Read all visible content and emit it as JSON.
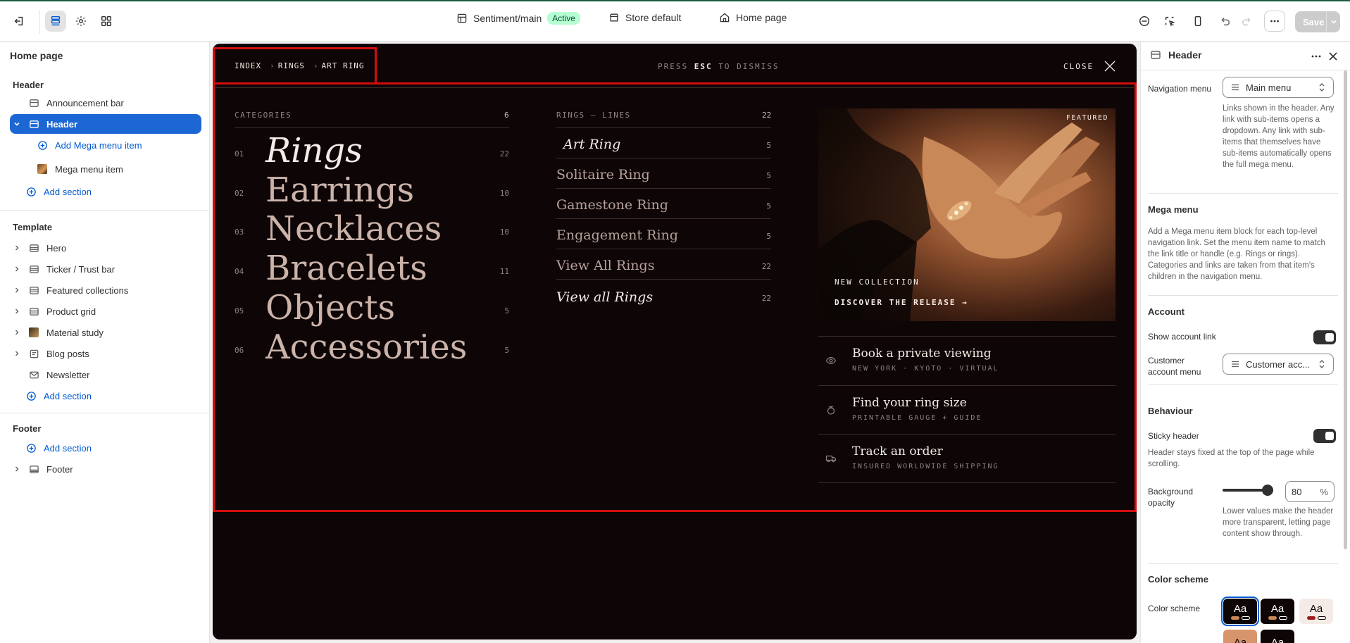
{
  "topbar": {
    "theme_name": "Sentiment/main",
    "status_badge": "Active",
    "store": "Store default",
    "page": "Home page",
    "save_label": "Save"
  },
  "left_panel": {
    "title": "Home page",
    "header_section": "Header",
    "header_items": [
      "Announcement bar",
      "Header",
      "Add Mega menu item",
      "Mega menu item",
      "Add section"
    ],
    "template_section": "Template",
    "template_items": [
      "Hero",
      "Ticker / Trust bar",
      "Featured collections",
      "Product grid",
      "Material study",
      "Blog posts",
      "Newsletter",
      "Add section"
    ],
    "footer_section": "Footer",
    "footer_items": [
      "Add section",
      "Footer"
    ]
  },
  "preview": {
    "breadcrumb": [
      "INDEX",
      "›",
      "RINGS",
      "›",
      "ART RING"
    ],
    "dismiss_pre": "PRESS",
    "dismiss_key": "ESC",
    "dismiss_post": "TO DISMISS",
    "close_label": "CLOSE",
    "categories_label": "CATEGORIES",
    "categories_count": "6",
    "categories": [
      {
        "num": "01",
        "name": "Rings",
        "count": "22"
      },
      {
        "num": "02",
        "name": "Earrings",
        "count": "10"
      },
      {
        "num": "03",
        "name": "Necklaces",
        "count": "10"
      },
      {
        "num": "04",
        "name": "Bracelets",
        "count": "11"
      },
      {
        "num": "05",
        "name": "Objects",
        "count": "5"
      },
      {
        "num": "06",
        "name": "Accessories",
        "count": "5"
      }
    ],
    "lines_label": "RINGS — LINES",
    "lines_count": "22",
    "lines": [
      {
        "name": "Art Ring",
        "count": "5"
      },
      {
        "name": "Solitaire Ring",
        "count": "5"
      },
      {
        "name": "Gamestone Ring",
        "count": "5"
      },
      {
        "name": "Engagement Ring",
        "count": "5"
      },
      {
        "name": "View All Rings",
        "count": "22"
      },
      {
        "name": "View all Rings",
        "count": "22"
      }
    ],
    "featured_tag": "FEATURED",
    "featured_kicker": "NEW COLLECTION",
    "featured_cta": "DISCOVER THE RELEASE →",
    "services": [
      {
        "title": "Book a private viewing",
        "sub": "NEW YORK · KYOTO · VIRTUAL",
        "icon": "eye-icon"
      },
      {
        "title": "Find your ring size",
        "sub": "PRINTABLE GAUGE + GUIDE",
        "icon": "ring-icon"
      },
      {
        "title": "Track an order",
        "sub": "INSURED WORLDWIDE SHIPPING",
        "icon": "truck-icon"
      }
    ]
  },
  "right_panel": {
    "title": "Header",
    "nav_menu_label": "Navigation menu",
    "nav_menu_value": "Main menu",
    "nav_menu_help": "Links shown in the header. Any link with sub-items opens a dropdown. Any link with sub-items that themselves have sub-items automatically opens the full mega menu.",
    "mega_title": "Mega menu",
    "mega_help": "Add a Mega menu item block for each top-level navigation link. Set the menu item name to match the link title or handle (e.g. Rings or rings). Categories and links are taken from that item's children in the navigation menu.",
    "account_title": "Account",
    "show_account_label": "Show account link",
    "customer_menu_label": "Customer account menu",
    "customer_menu_value": "Customer acc...",
    "behaviour_title": "Behaviour",
    "sticky_label": "Sticky header",
    "sticky_help": "Header stays fixed at the top of the page while scrolling.",
    "bg_opacity_label": "Background opacity",
    "bg_opacity_value": "80",
    "bg_opacity_unit": "%",
    "bg_opacity_help": "Lower values make the header more transparent, letting page content show through.",
    "color_scheme_title": "Color scheme",
    "color_scheme_label": "Color scheme",
    "swatch_text": "Aa"
  }
}
